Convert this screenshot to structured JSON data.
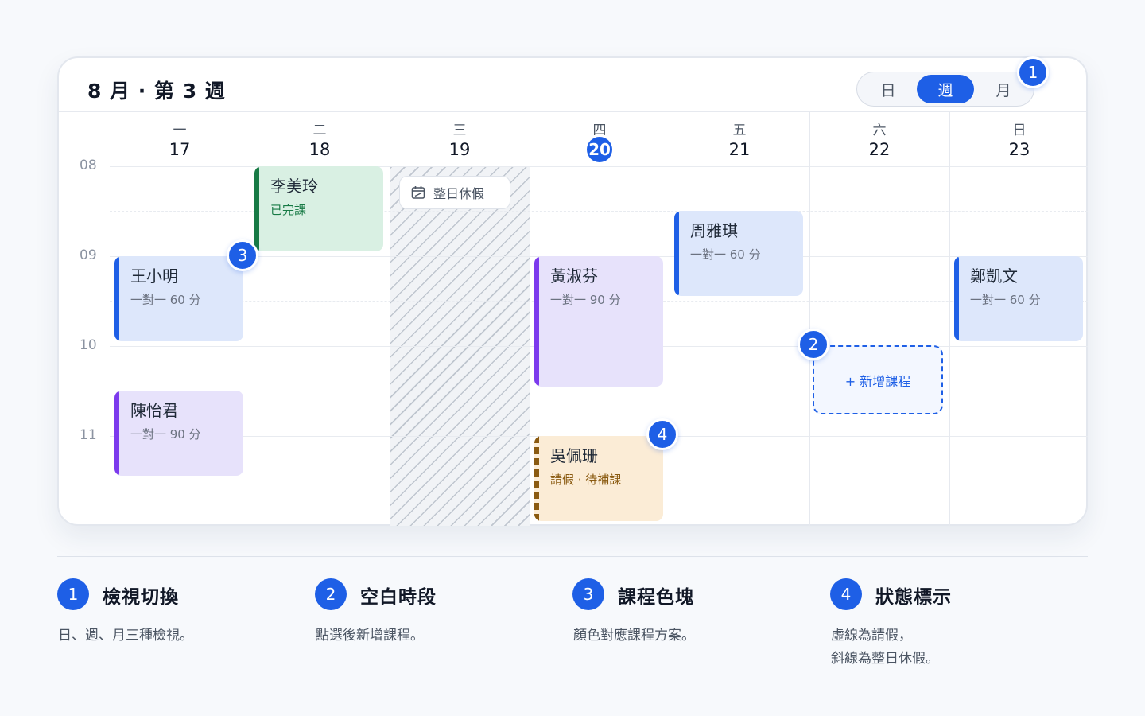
{
  "calendar": {
    "title": "8 月 · 第 3 週",
    "view_toggle": {
      "day": "日",
      "week": "週",
      "month": "月",
      "active": "week"
    },
    "days": [
      {
        "weekday": "一",
        "date": "17"
      },
      {
        "weekday": "二",
        "date": "18"
      },
      {
        "weekday": "三",
        "date": "19"
      },
      {
        "weekday": "四",
        "date": "20",
        "today": true
      },
      {
        "weekday": "五",
        "date": "21"
      },
      {
        "weekday": "六",
        "date": "22"
      },
      {
        "weekday": "日",
        "date": "23"
      }
    ],
    "hours": [
      "08",
      "09",
      "10",
      "11"
    ],
    "holiday_label": "整日休假",
    "add_slot_label": "+ 新增課程",
    "events": [
      {
        "name": "李美玲",
        "sub": "已完課",
        "status": "completed"
      },
      {
        "name": "王小明",
        "sub": "一對一 60 分"
      },
      {
        "name": "陳怡君",
        "sub": "一對一 90 分"
      },
      {
        "name": "黃淑芬",
        "sub": "一對一 90 分"
      },
      {
        "name": "吳佩珊",
        "sub": "請假 · 待補課",
        "status": "leave"
      },
      {
        "name": "周雅琪",
        "sub": "一對一 60 分"
      },
      {
        "name": "鄭凱文",
        "sub": "一對一 60 分"
      }
    ],
    "markers": [
      "1",
      "2",
      "3",
      "4"
    ]
  },
  "legend": [
    {
      "num": "1",
      "title": "檢視切換",
      "desc": "日、週、月三種檢視。"
    },
    {
      "num": "2",
      "title": "空白時段",
      "desc": "點選後新增課程。"
    },
    {
      "num": "3",
      "title": "課程色塊",
      "desc": "顏色對應課程方案。"
    },
    {
      "num": "4",
      "title": "狀態標示",
      "desc_line1": "虛線為請假，",
      "desc_line2": "斜線為整日休假。"
    }
  ],
  "colors": {
    "accent": "#1e5fe6",
    "blue_event": "#dde7fb",
    "purple_event": "#e7e2fb",
    "green_event": "#d9f0e3",
    "amber_event": "#fbecd6"
  }
}
